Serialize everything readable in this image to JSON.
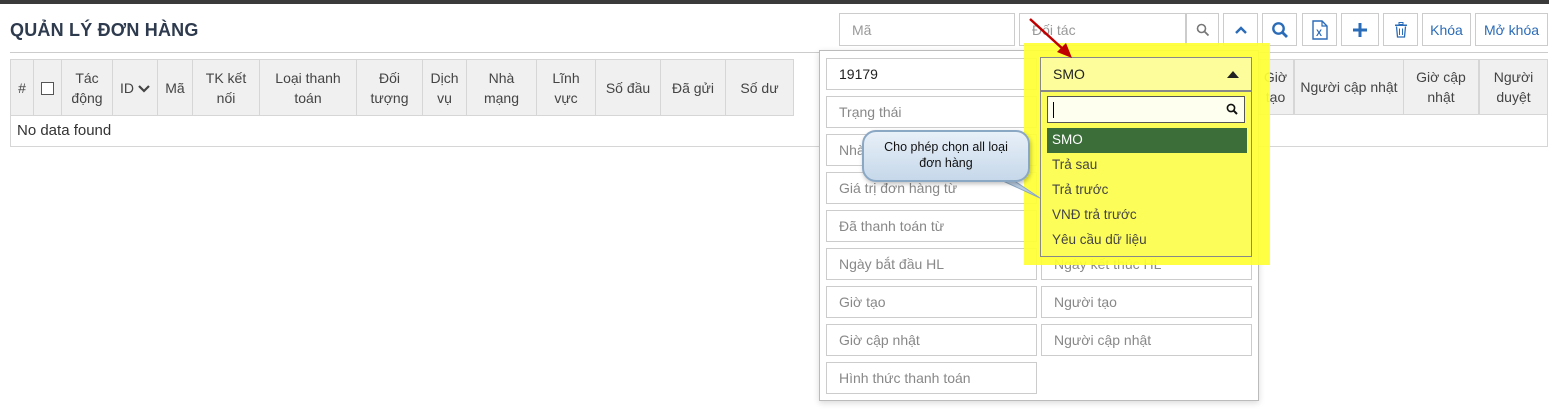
{
  "page": {
    "title": "QUẢN LÝ ĐƠN HÀNG"
  },
  "toolbar": {
    "code_placeholder": "Mã",
    "partner_placeholder": "Đối tác",
    "lock_label": "Khóa",
    "unlock_label": "Mở khóa"
  },
  "table": {
    "headers_left": [
      "#",
      "",
      "Tác động",
      "ID",
      "Mã",
      "TK kết nối",
      "Loại thanh toán",
      "Đối tượng",
      "Dịch vụ",
      "Nhà mạng",
      "Lĩnh vực",
      "Số đầu",
      "Đã gửi",
      "Số dư"
    ],
    "headers_right": [
      "Giờ tạo",
      "Người cập nhật",
      "Giờ cập nhật",
      "Người duyệt"
    ],
    "empty_text": "No data found"
  },
  "filter_panel": {
    "id_value": "19179",
    "status_placeholder": "Trạng thái",
    "carrier_placeholder": "Nhà mạng",
    "order_value_from": "Giá trị đơn hàng từ",
    "paid_from": "Đã thanh toán từ",
    "start_date": "Ngày bắt đầu HL",
    "end_date": "Ngày kết thúc HL",
    "created_time": "Giờ tạo",
    "creator": "Người tạo",
    "updated_time": "Giờ cập nhật",
    "updater": "Người cập nhật",
    "payment_method": "Hình thức thanh toán"
  },
  "order_type_dropdown": {
    "selected": "SMO",
    "search_value": "",
    "options": [
      "SMO",
      "Trả sau",
      "Trả trước",
      "VNĐ trả trước",
      "Yêu cầu dữ liệu"
    ]
  },
  "annotation": {
    "callout_text": "Cho phép chọn all loại đơn hàng"
  },
  "colors": {
    "highlight": "#ffff33",
    "active_option": "#3c6e3a",
    "accent": "#2b6cb8",
    "arrow": "#c00000"
  }
}
